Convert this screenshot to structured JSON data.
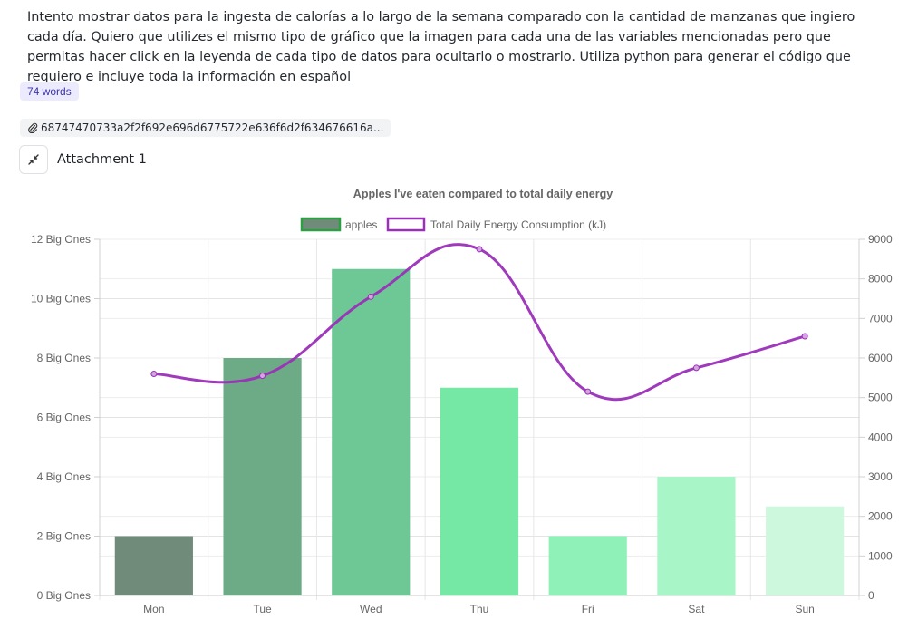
{
  "prompt": {
    "text": "Intento mostrar datos para la ingesta de calorías a lo largo de la semana comparado con la cantidad de manzanas que ingiero cada día. Quiero que utilizes el mismo tipo de gráfico que la imagen para cada una de las variables mencionadas pero que permitas hacer click en la leyenda de cada tipo de datos para ocultarlo o mostrarlo. Utiliza python para generar el código que requiero e incluye toda la información en español"
  },
  "word_count": "74 words",
  "attachment_chip": {
    "icon": "paperclip-icon",
    "filename": "68747470733a2f2f692e696d6775722e636f6d2f634676616a..."
  },
  "attachment": {
    "icon": "collapse-arrows-icon",
    "label": "Attachment 1"
  },
  "chart_data": {
    "type": "bar",
    "title": "Apples I've eaten compared to total daily energy",
    "categories": [
      "Mon",
      "Tue",
      "Wed",
      "Thu",
      "Fri",
      "Sat",
      "Sun"
    ],
    "y_left": {
      "ylim": [
        0,
        12
      ],
      "ticks": [
        "0 Big Ones",
        "2 Big Ones",
        "4 Big Ones",
        "6 Big Ones",
        "8 Big Ones",
        "10 Big Ones",
        "12 Big Ones"
      ],
      "tick_values": [
        0,
        2,
        4,
        6,
        8,
        10,
        12
      ]
    },
    "y_right": {
      "ylim": [
        0,
        9000
      ],
      "ticks": [
        "0",
        "1000",
        "2000",
        "3000",
        "4000",
        "5000",
        "6000",
        "7000",
        "8000",
        "9000"
      ],
      "tick_values": [
        0,
        1000,
        2000,
        3000,
        4000,
        5000,
        6000,
        7000,
        8000,
        9000
      ]
    },
    "series": [
      {
        "name": "apples",
        "type": "bar",
        "axis": "left",
        "values": [
          2,
          8,
          11,
          7,
          2,
          4,
          3
        ],
        "colors": [
          "#708b7a",
          "#6dab86",
          "#6dc895",
          "#76e8a6",
          "#90f1b8",
          "#a8f5c7",
          "#cdf8de"
        ]
      },
      {
        "name": "Total Daily Energy Consumption (kJ)",
        "type": "line",
        "axis": "right",
        "values": [
          5600,
          5550,
          7550,
          8750,
          5150,
          5750,
          6550
        ],
        "color": "#9b2fb8"
      }
    ],
    "legend_position": "top",
    "grid": true
  }
}
